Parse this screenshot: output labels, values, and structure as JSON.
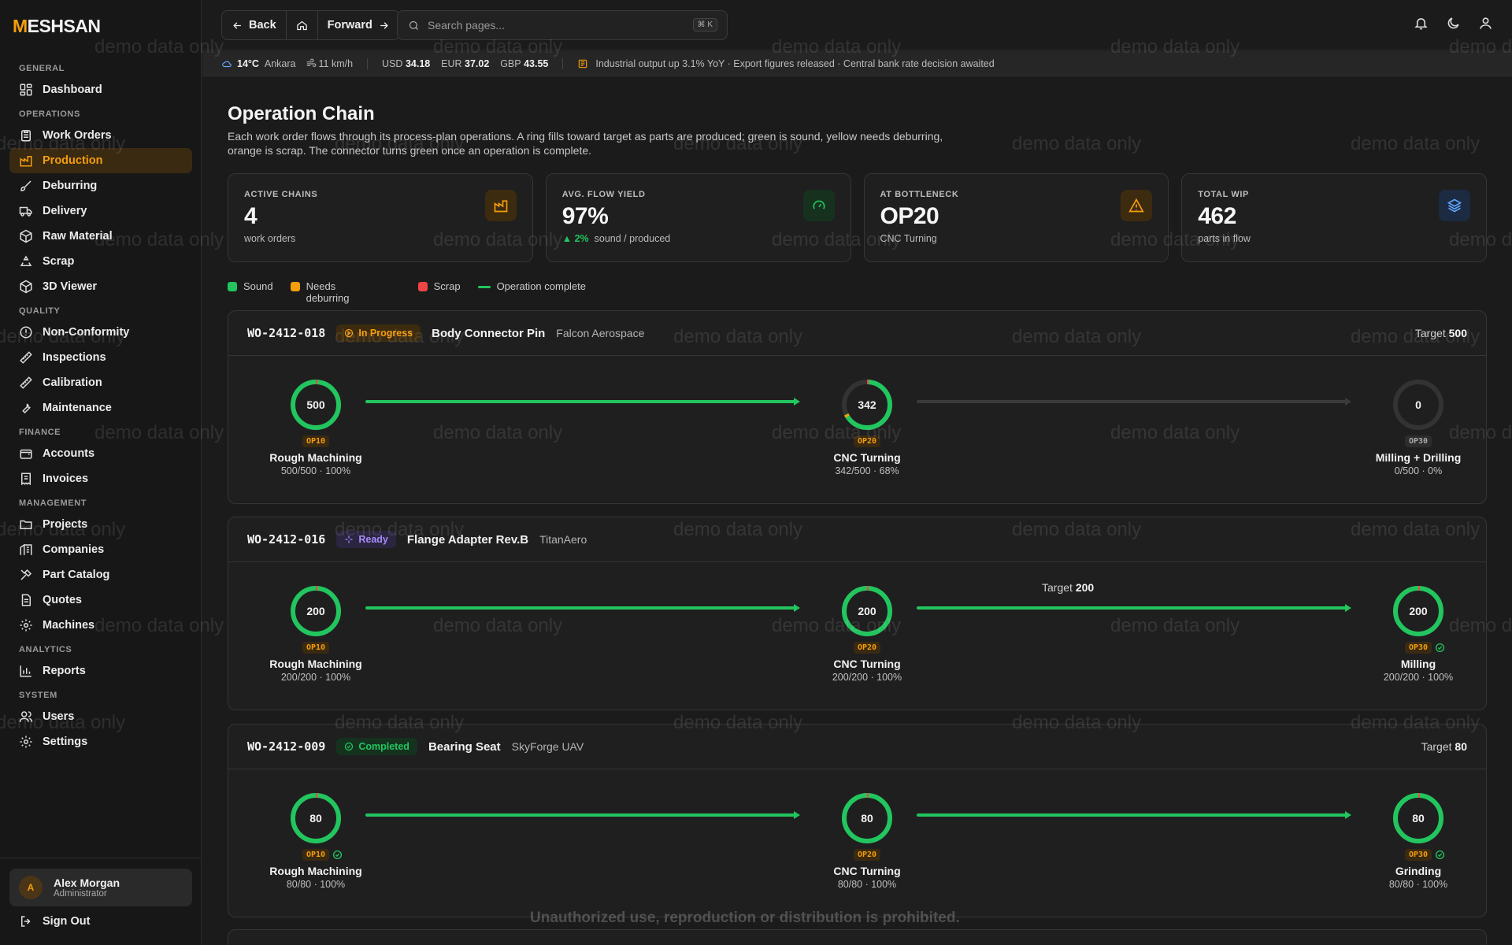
{
  "app": {
    "logo_mark": "M",
    "logo_rest": "ESHSAN"
  },
  "sidebar": {
    "sections": {
      "general": "GENERAL",
      "operations": "OPERATIONS",
      "quality": "QUALITY",
      "finance": "FINANCE",
      "management": "MANAGEMENT",
      "analytics": "ANALYTICS",
      "system": "SYSTEM"
    },
    "items": {
      "dashboard": "Dashboard",
      "work_orders": "Work Orders",
      "production": "Production",
      "deburring": "Deburring",
      "delivery": "Delivery",
      "raw_material": "Raw Material",
      "scrap": "Scrap",
      "viewer": "3D Viewer",
      "non_conformity": "Non-Conformity",
      "inspections": "Inspections",
      "calibration": "Calibration",
      "maintenance": "Maintenance",
      "accounts": "Accounts",
      "invoices": "Invoices",
      "projects": "Projects",
      "companies": "Companies",
      "part_catalog": "Part Catalog",
      "quotes": "Quotes",
      "machines": "Machines",
      "reports": "Reports",
      "users": "Users",
      "settings": "Settings"
    },
    "user": {
      "initial": "A",
      "name": "Alex Morgan",
      "role": "Administrator"
    },
    "sign_out": "Sign Out"
  },
  "topbar": {
    "back": "Back",
    "forward": "Forward",
    "search_placeholder": "Search pages...",
    "shortcut": "⌘ K"
  },
  "ticker": {
    "temp": "14°C",
    "city": "Ankara",
    "wind": "11 km/h",
    "usd_label": "USD",
    "usd": "34.18",
    "eur_label": "EUR",
    "eur": "37.02",
    "gbp_label": "GBP",
    "gbp": "43.55",
    "news": "Industrial output up 3.1% YoY · Export figures released · Central bank rate decision awaited"
  },
  "page": {
    "title": "Operation Chain",
    "description": "Each work order flows through its process-plan operations. A ring fills toward target as parts are produced; green is sound, yellow needs deburring, orange is scrap. The connector turns green once an operation is complete."
  },
  "kpis": [
    {
      "label": "ACTIVE CHAINS",
      "value": "4",
      "sub": "work orders",
      "icon": "factory-icon",
      "color": "#f59e0b"
    },
    {
      "label": "AVG. FLOW YIELD",
      "value": "97%",
      "delta": "2%",
      "sub": "sound / produced",
      "icon": "gauge-icon",
      "color": "#22c55e"
    },
    {
      "label": "AT BOTTLENECK",
      "value": "OP20",
      "sub": "CNC Turning",
      "icon": "warning-icon",
      "color": "#f59e0b"
    },
    {
      "label": "TOTAL WIP",
      "value": "462",
      "sub": "parts in flow",
      "icon": "layers-icon",
      "color": "#60a5fa"
    }
  ],
  "legend": {
    "sound": "Sound",
    "needs": "Needs deburring",
    "scrap": "Scrap",
    "complete": "Operation complete"
  },
  "colors": {
    "sound": "#22c55e",
    "needs": "#f59e0b",
    "scrap": "#ef4444",
    "accent": "#f59e0b",
    "ready": "#a78bfa"
  },
  "chains": [
    {
      "wo": "WO-2412-018",
      "status": "In Progress",
      "part": "Body Connector Pin",
      "company": "Falcon Aerospace",
      "target_label": "Target",
      "target": "500",
      "ops": [
        {
          "code": "OP10",
          "name": "Rough Machining",
          "value": "500",
          "stat": "500/500 · 100%",
          "progress": 1.0,
          "complete": false
        },
        {
          "code": "OP20",
          "name": "CNC Turning",
          "value": "342",
          "stat": "342/500 · 68%",
          "progress": 0.68,
          "complete": false
        },
        {
          "code": "OP30",
          "name": "Milling + Drilling",
          "value": "0",
          "stat": "0/500 · 0%",
          "progress": 0,
          "complete": false
        }
      ],
      "connectors": [
        true,
        false
      ]
    },
    {
      "wo": "WO-2412-016",
      "status": "Ready",
      "part": "Flange Adapter Rev.B",
      "company": "TitanAero",
      "target_label": "Target",
      "target": "200",
      "ops": [
        {
          "code": "OP10",
          "name": "Rough Machining",
          "value": "200",
          "stat": "200/200 · 100%",
          "progress": 1.0,
          "complete": false
        },
        {
          "code": "OP20",
          "name": "CNC Turning",
          "value": "200",
          "stat": "200/200 · 100%",
          "progress": 1.0,
          "complete": false
        },
        {
          "code": "OP30",
          "name": "Milling",
          "value": "200",
          "stat": "200/200 · 100%",
          "progress": 1.0,
          "complete": true
        }
      ],
      "connectors": [
        true,
        true
      ]
    },
    {
      "wo": "WO-2412-009",
      "status": "Completed",
      "part": "Bearing Seat",
      "company": "SkyForge UAV",
      "target_label": "Target",
      "target": "80",
      "ops": [
        {
          "code": "OP10",
          "name": "Rough Machining",
          "value": "80",
          "stat": "80/80 · 100%",
          "progress": 1.0,
          "complete": true
        },
        {
          "code": "OP20",
          "name": "CNC Turning",
          "value": "80",
          "stat": "80/80 · 100%",
          "progress": 1.0,
          "complete": false
        },
        {
          "code": "OP30",
          "name": "Grinding",
          "value": "80",
          "stat": "80/80 · 100%",
          "progress": 1.0,
          "complete": true
        }
      ],
      "connectors": [
        true,
        true
      ]
    }
  ],
  "watermark": "demo data only",
  "copyright": "Unauthorized use, reproduction or distribution is prohibited."
}
